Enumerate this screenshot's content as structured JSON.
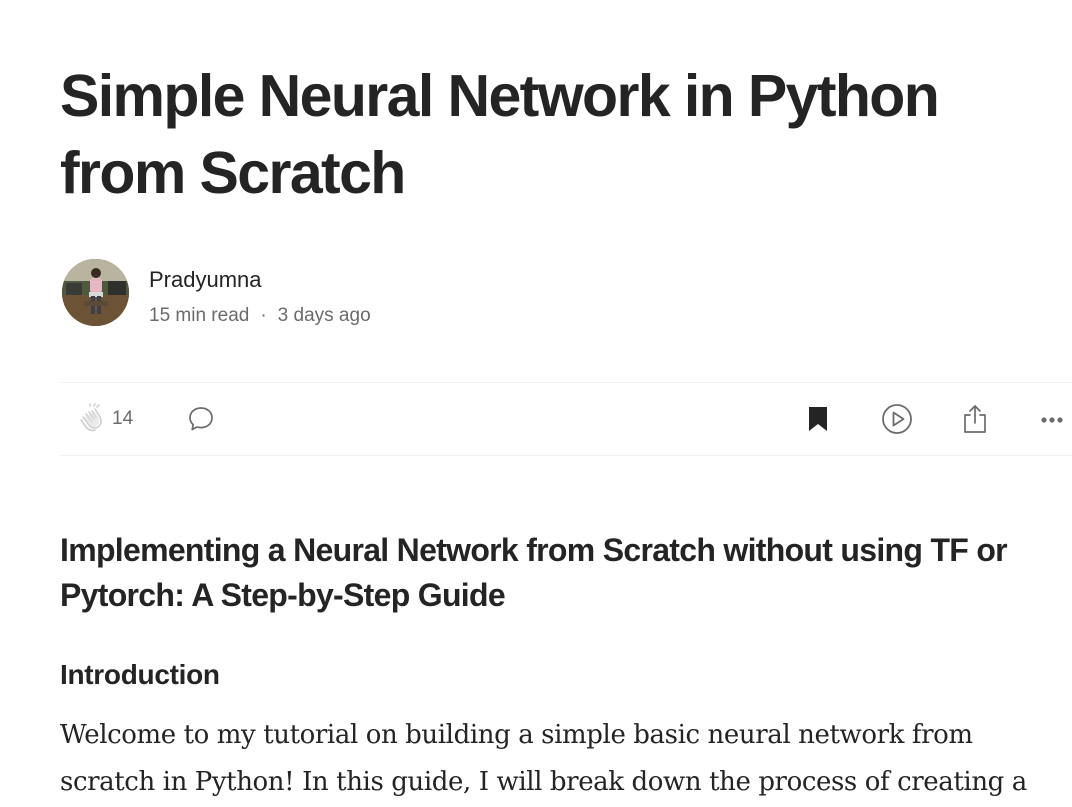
{
  "article": {
    "title": "Simple Neural Network in Python from Scratch",
    "author": {
      "name": "Pradyumna",
      "read_time": "15 min read",
      "separator": "·",
      "published": "3 days ago",
      "avatar_icon": "author-photo"
    },
    "actions": {
      "clap_icon": "clap-icon",
      "clap_count": "14",
      "comment_icon": "comment-bubble-icon",
      "save_icon": "bookmark-filled-icon",
      "listen_icon": "play-circle-icon",
      "share_icon": "share-upload-icon",
      "more_icon": "more-dots-icon"
    },
    "subtitle": "Implementing a Neural Network from Scratch without using TF or Pytorch: A Step-by-Step Guide",
    "sections": [
      {
        "heading": "Introduction",
        "paragraph": "Welcome to my tutorial on building a simple basic neural network from scratch in Python! In this guide, I will break down the process of creating a"
      }
    ]
  },
  "colors": {
    "text": "#242424",
    "muted": "#6b6b6b",
    "divider": "#f2f2f2",
    "background": "#ffffff"
  }
}
